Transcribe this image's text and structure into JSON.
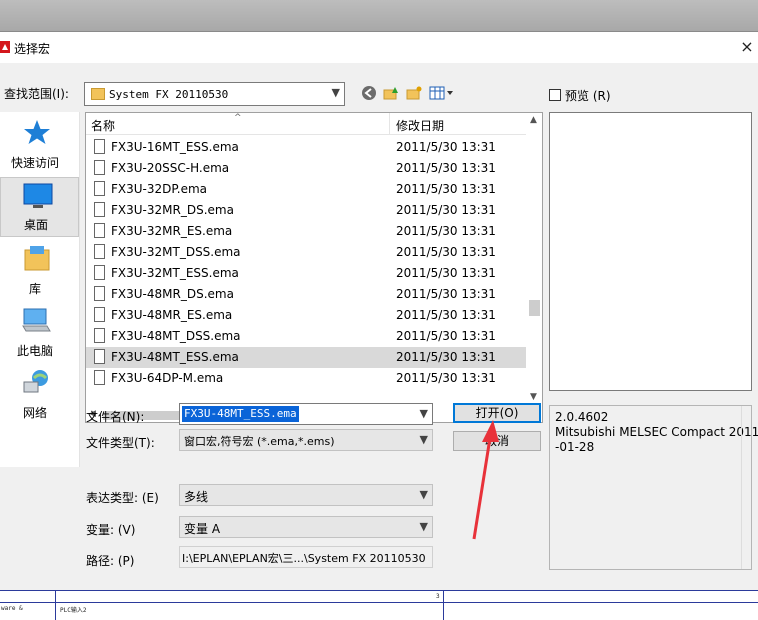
{
  "dialog": {
    "title": "选择宏",
    "close_glyph": "×",
    "look_in_label": "查找范围(I):",
    "look_in_value": "System FX 20110530",
    "preview_label": "预览 (R)",
    "places": [
      {
        "label": "快速访问",
        "icon": "star-icon"
      },
      {
        "label": "桌面",
        "icon": "desktop-icon"
      },
      {
        "label": "库",
        "icon": "library-icon"
      },
      {
        "label": "此电脑",
        "icon": "computer-icon"
      },
      {
        "label": "网络",
        "icon": "network-icon"
      }
    ],
    "columns": {
      "name": "名称",
      "modified": "修改日期"
    },
    "files": [
      {
        "name": "FX3U-16MT_ESS.ema",
        "date": "2011/5/30 13:31"
      },
      {
        "name": "FX3U-20SSC-H.ema",
        "date": "2011/5/30 13:31"
      },
      {
        "name": "FX3U-32DP.ema",
        "date": "2011/5/30 13:31"
      },
      {
        "name": "FX3U-32MR_DS.ema",
        "date": "2011/5/30 13:31"
      },
      {
        "name": "FX3U-32MR_ES.ema",
        "date": "2011/5/30 13:31"
      },
      {
        "name": "FX3U-32MT_DSS.ema",
        "date": "2011/5/30 13:31"
      },
      {
        "name": "FX3U-32MT_ESS.ema",
        "date": "2011/5/30 13:31"
      },
      {
        "name": "FX3U-48MR_DS.ema",
        "date": "2011/5/30 13:31"
      },
      {
        "name": "FX3U-48MR_ES.ema",
        "date": "2011/5/30 13:31"
      },
      {
        "name": "FX3U-48MT_DSS.ema",
        "date": "2011/5/30 13:31"
      },
      {
        "name": "FX3U-48MT_ESS.ema",
        "date": "2011/5/30 13:31",
        "selected": true
      },
      {
        "name": "FX3U-64DP-M.ema",
        "date": "2011/5/30 13:31"
      }
    ],
    "filename_label": "文件名(N):",
    "filename_value": "FX3U-48MT_ESS.ema",
    "filetype_label": "文件类型(T):",
    "filetype_value": "窗口宏,符号宏 (*.ema,*.ems)",
    "open_button": "打开(O)",
    "cancel_button": "取消",
    "info_lines": [
      "2.0.4602",
      "Mitsubishi MELSEC Compact 2011",
      "-01-28"
    ],
    "representation_label": "表达类型: (E)",
    "representation_value": "多线",
    "variant_label": "变量: (V)",
    "variant_value": "变量 A",
    "path_label": "路径: (P)",
    "path_value": "I:\\EPLAN\\EPLAN宏\\三...\\System FX 20110530"
  },
  "background": {
    "corner_text": "ware &",
    "cell_text": "PLC输入2",
    "sheet_number": "3"
  },
  "colors": {
    "annotation_arrow": "#e8323a",
    "selection": "#0a64d8",
    "sheet_lines": "#2b3a9b"
  }
}
